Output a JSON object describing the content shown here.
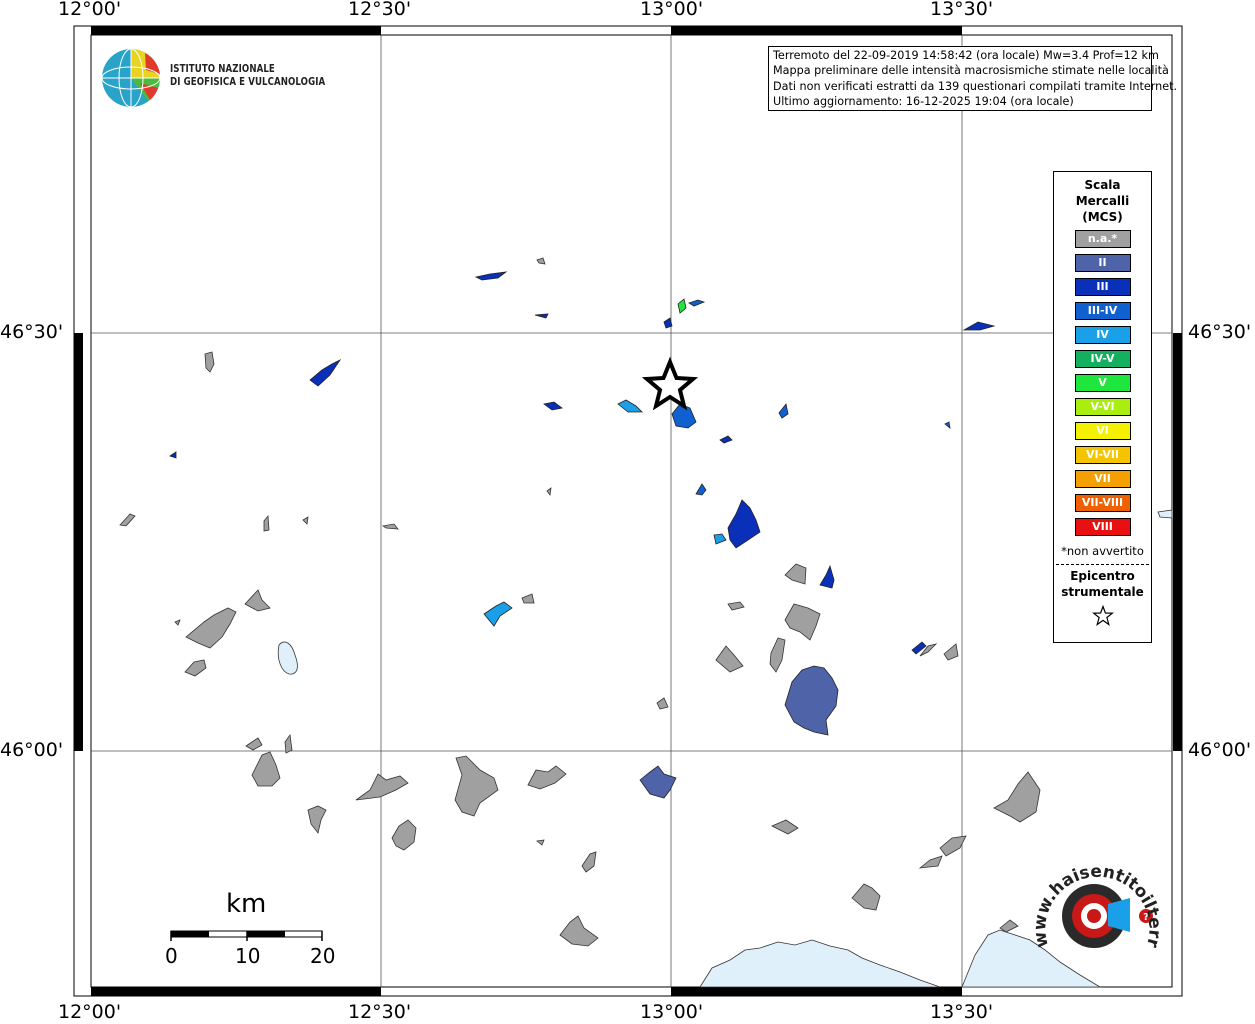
{
  "map": {
    "lon_labels": [
      "12°00'",
      "12°30'",
      "13°00'",
      "13°30'"
    ],
    "lat_labels": [
      "46°30'",
      "46°00'"
    ],
    "water_color": "#dff0fb",
    "felt_outline_color": "#333333"
  },
  "institute": {
    "line1": "ISTITUTO NAZIONALE",
    "line2": "DI GEOFISICA E VULCANOLOGIA",
    "logo_icon": "ingv-globe-icon"
  },
  "info": {
    "line1": "Terremoto del 22-09-2019 14:58:42 (ora locale) Mw=3.4 Prof=12 km",
    "line2": "Mappa preliminare delle intensità macrosismiche stimate nelle località",
    "line3": "Dati non verificati estratti da 139 questionari compilati tramite Internet.",
    "line4": "Ultimo aggiornamento: 16-12-2025 19:04 (ora locale)"
  },
  "legend": {
    "title1": "Scala",
    "title2": "Mercalli",
    "title3": "(MCS)",
    "items": [
      {
        "label": "n.a.*",
        "color": "#a0a0a0"
      },
      {
        "label": "II",
        "color": "#4f64a8"
      },
      {
        "label": "III",
        "color": "#0a2fb8"
      },
      {
        "label": "III-IV",
        "color": "#1060d0"
      },
      {
        "label": "IV",
        "color": "#1aa0e8"
      },
      {
        "label": "IV-V",
        "color": "#14b060"
      },
      {
        "label": "V",
        "color": "#1ee63c"
      },
      {
        "label": "V-VI",
        "color": "#aaee10"
      },
      {
        "label": "VI",
        "color": "#f5f000"
      },
      {
        "label": "VI-VII",
        "color": "#f5c400"
      },
      {
        "label": "VII",
        "color": "#f5a000"
      },
      {
        "label": "VII-VIII",
        "color": "#f06000"
      },
      {
        "label": "VIII",
        "color": "#e81010"
      }
    ],
    "note": "*non avvertito",
    "epicenter1": "Epicentro",
    "epicenter2": "strumentale",
    "epicenter_icon": "star-icon"
  },
  "scalebar": {
    "unit": "km",
    "labels": [
      "0",
      "10",
      "20"
    ]
  },
  "watermark": {
    "text": "www.haisentitoilterremoto.it",
    "icon": "haisentito-target-icon"
  }
}
